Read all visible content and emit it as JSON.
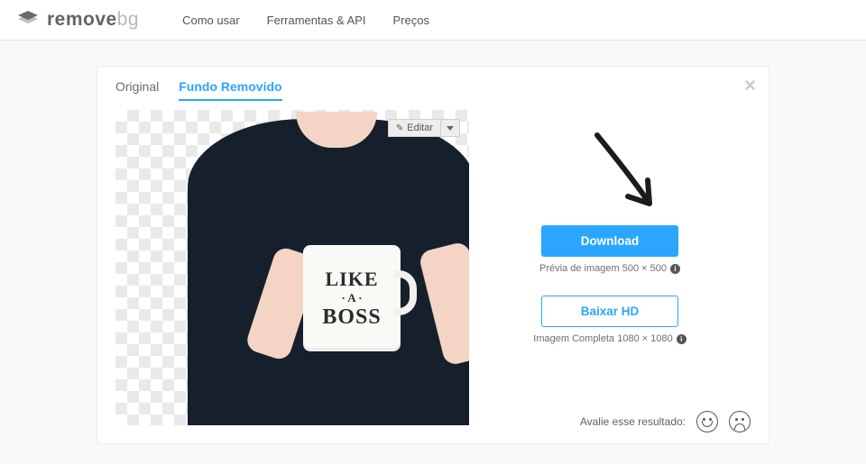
{
  "header": {
    "logo_bold": "remove",
    "logo_light": "bg",
    "nav": [
      "Como usar",
      "Ferramentas & API",
      "Preços"
    ]
  },
  "tabs": {
    "original": "Original",
    "removed": "Fundo Removido"
  },
  "editor": {
    "edit_label": "Editar"
  },
  "mug": {
    "line1": "LIKE",
    "line2": "· A ·",
    "line3": "BOSS"
  },
  "actions": {
    "download_label": "Download",
    "download_caption": "Prévia de imagem 500 × 500",
    "hd_label": "Baixar HD",
    "hd_caption": "Imagem Completa 1080 × 1080"
  },
  "rating": {
    "prompt": "Avalie esse resultado:"
  }
}
